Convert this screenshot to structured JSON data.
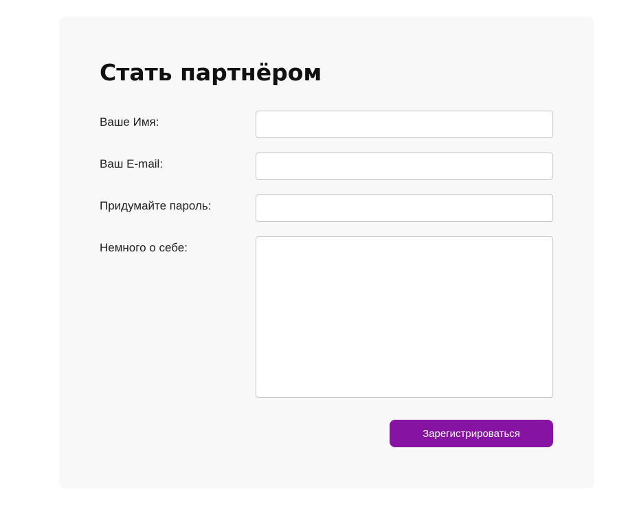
{
  "form": {
    "title": "Стать партнёром",
    "fields": [
      {
        "label": "Ваше Имя:",
        "value": "",
        "placeholder": ""
      },
      {
        "label": "Ваш E-mail:",
        "value": "",
        "placeholder": ""
      },
      {
        "label": "Придумайте пароль:",
        "value": "",
        "placeholder": ""
      },
      {
        "label": "Немного о себе:",
        "value": "",
        "placeholder": ""
      }
    ],
    "submit_label": "Зарегистрироваться"
  },
  "colors": {
    "card_background": "#f8f8f8",
    "accent": "#8713a3",
    "field_border": "#c8c8c8"
  }
}
